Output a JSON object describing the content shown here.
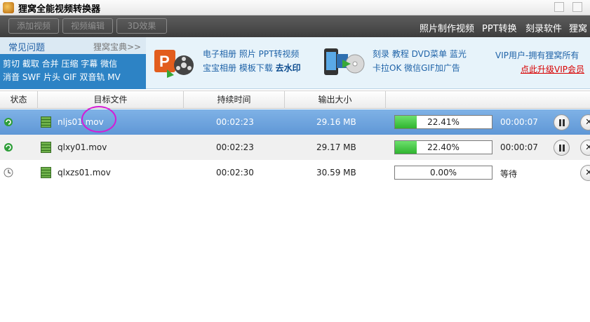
{
  "window": {
    "title": "狸窝全能视频转换器"
  },
  "toolbar": {
    "buttons": [
      "添加视频",
      "视频编辑",
      "3D效果"
    ],
    "links": [
      "照片制作视频",
      "PPT转换",
      "刻录软件",
      "狸窝"
    ]
  },
  "faq": {
    "title": "常见问题",
    "more": "狸窝宝典>>",
    "row1": "剪切 截取 合并 压缩 字幕 微信",
    "row2": "消音 SWF 片头 GIF 双音轨 MV"
  },
  "promo": {
    "ppt_line1": "电子相册 照片 PPT转视频",
    "ppt_line2": "宝宝相册 模板下载",
    "ppt_line2_bold": "去水印",
    "dvd_line1": "刻录 教程 DVD菜单 蓝光",
    "dvd_line2": "卡拉OK 微信GIF加广告",
    "vip_text": "VIP用户-拥有狸窝所有",
    "vip_link": "点此升级VIP会员"
  },
  "table": {
    "headers": [
      "状态",
      "目标文件",
      "持续时间",
      "输出大小",
      ""
    ],
    "rows": [
      {
        "file": "nljs01.mov",
        "duration": "00:02:23",
        "size": "29.16 MB",
        "progress_text": "22.41%",
        "progress": 0.2241,
        "elapsed": "00:00:07",
        "status": "converting"
      },
      {
        "file": "qlxy01.mov",
        "duration": "00:02:23",
        "size": "29.17 MB",
        "progress_text": "22.40%",
        "progress": 0.224,
        "elapsed": "00:00:07",
        "status": "converting"
      },
      {
        "file": "qlxzs01.mov",
        "duration": "00:02:30",
        "size": "30.59 MB",
        "progress_text": "0.00%",
        "progress": 0.0,
        "elapsed": "等待",
        "status": "waiting"
      }
    ]
  },
  "colors": {
    "toolbar_bg": "#4a4a4a",
    "selected_row": "#6fa3dd",
    "progress_green": "#3cc03c",
    "faq_blue": "#2d83c5",
    "vip_red": "#d80000",
    "annotation": "#d61ad6"
  },
  "icons": {
    "app": "fox-logo-icon",
    "converting": "green-refresh-icon",
    "waiting": "clock-icon",
    "file": "film-strip-icon",
    "pause": "pause-icon",
    "close": "close-icon"
  }
}
